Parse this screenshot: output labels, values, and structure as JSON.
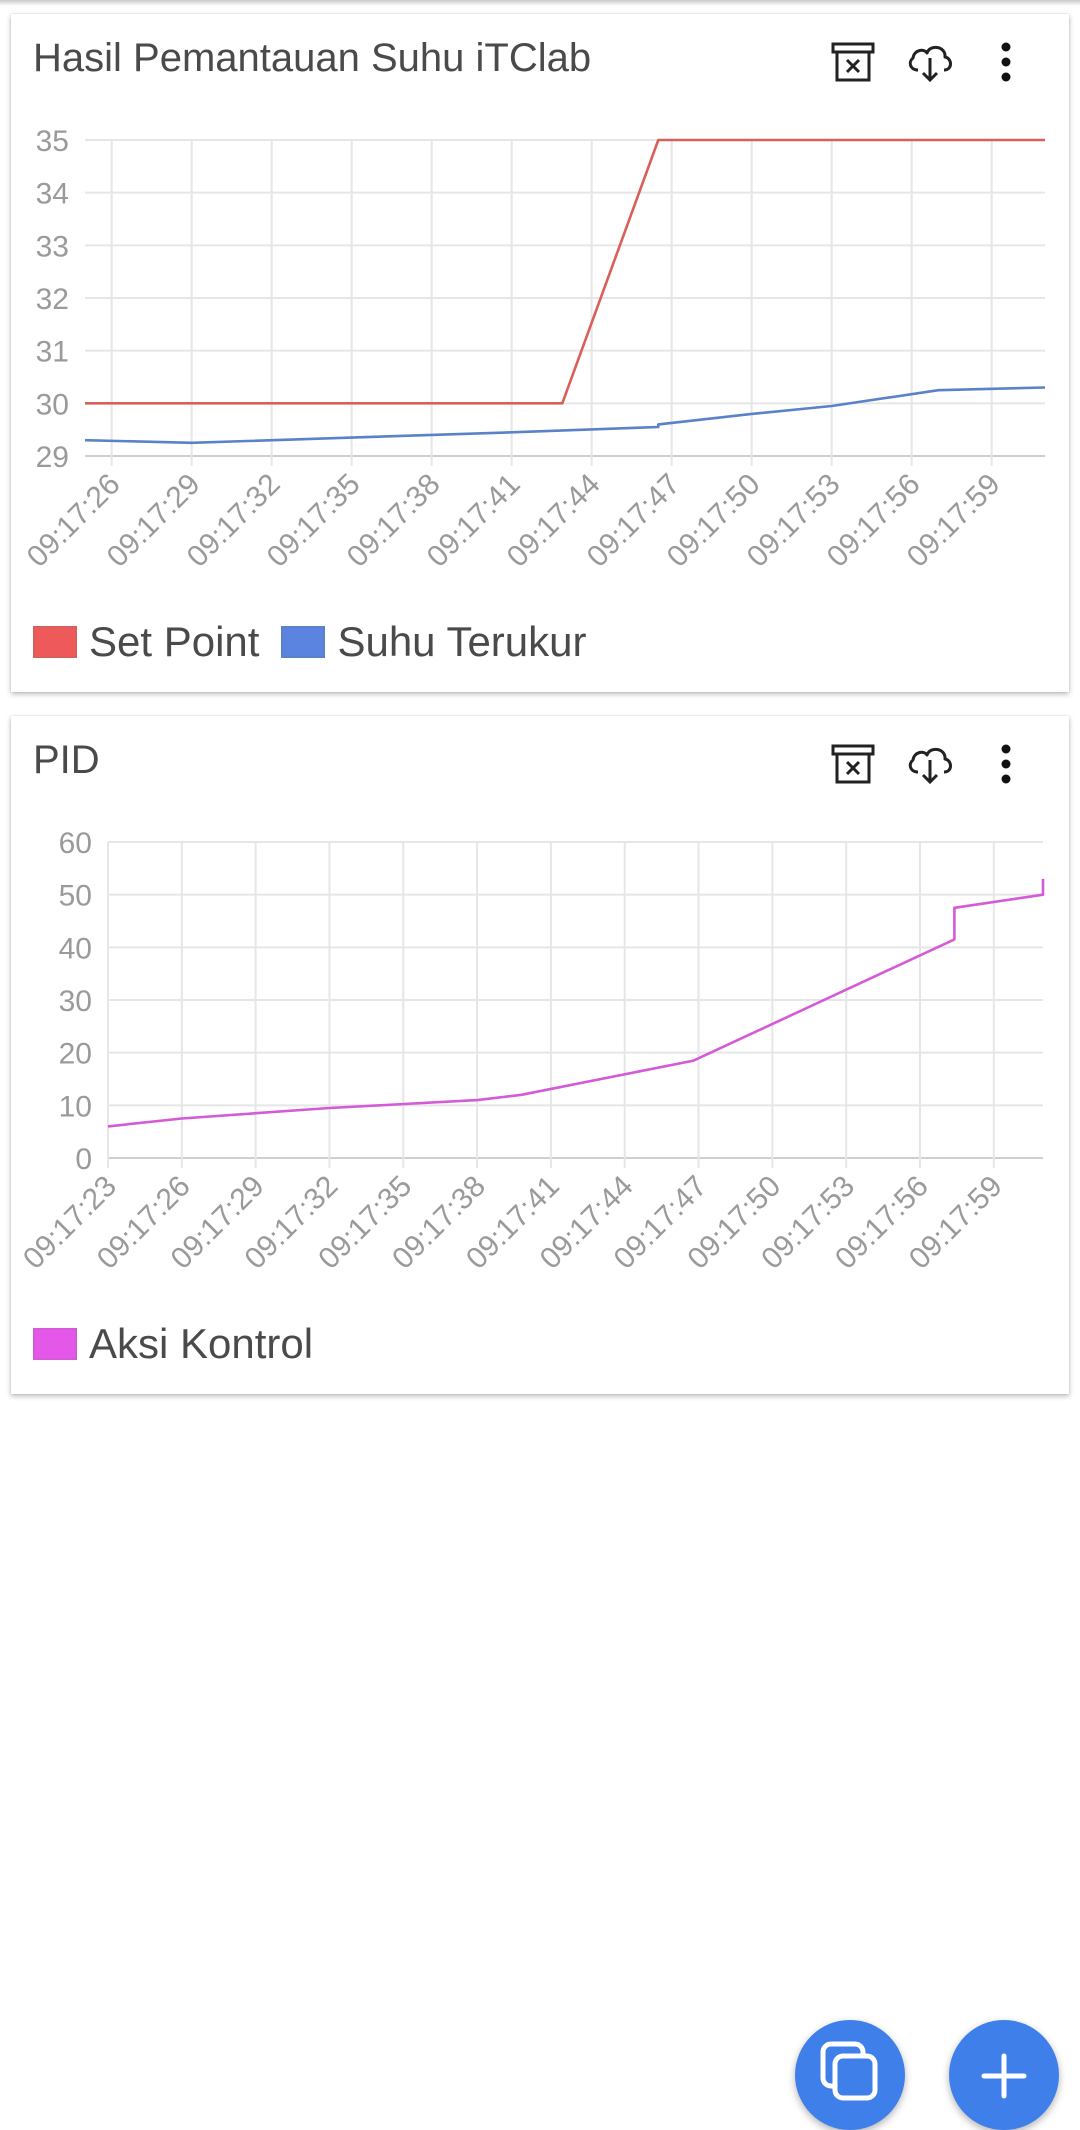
{
  "cards": [
    {
      "title": "Hasil Pemantauan Suhu iTClab",
      "actions": {
        "archive_icon": "archive-x-icon",
        "download_icon": "cloud-download-icon",
        "more_icon": "more-vertical-icon"
      }
    },
    {
      "title": "PID",
      "actions": {
        "archive_icon": "archive-x-icon",
        "download_icon": "cloud-download-icon",
        "more_icon": "more-vertical-icon"
      }
    }
  ],
  "fabs": {
    "copy_icon": "copy-icon",
    "add_icon": "plus-icon",
    "color": "#3f7fe9"
  },
  "chart_data": [
    {
      "type": "line",
      "title": "Hasil Pemantauan Suhu iTClab",
      "xlabel": "",
      "ylabel": "",
      "ylim": [
        29,
        35
      ],
      "yticks": [
        29,
        30,
        31,
        32,
        33,
        34,
        35
      ],
      "x_range": [
        "09:17:25",
        "09:18:01"
      ],
      "x_ticks": [
        "09:17:26",
        "09:17:29",
        "09:17:32",
        "09:17:35",
        "09:17:38",
        "09:17:41",
        "09:17:44",
        "09:17:47",
        "09:17:50",
        "09:17:53",
        "09:17:56",
        "09:17:59"
      ],
      "grid": true,
      "legend_position": "bottom-left",
      "series": [
        {
          "name": "Set Point",
          "color": "#d9605a",
          "legend_color": "#ee5a5a",
          "points": [
            [
              "09:17:25",
              30
            ],
            [
              "09:17:42.9",
              30
            ],
            [
              "09:17:46.5",
              35
            ],
            [
              "09:18:01",
              35
            ]
          ]
        },
        {
          "name": "Suhu Terukur",
          "color": "#5a82c8",
          "legend_color": "#5b84e0",
          "points": [
            [
              "09:17:25",
              29.3
            ],
            [
              "09:17:29",
              29.25
            ],
            [
              "09:17:35",
              29.35
            ],
            [
              "09:17:38",
              29.4
            ],
            [
              "09:17:41",
              29.45
            ],
            [
              "09:17:46.5",
              29.55
            ],
            [
              "09:17:46.5",
              29.6
            ],
            [
              "09:17:50",
              29.8
            ],
            [
              "09:17:53",
              29.95
            ],
            [
              "09:17:57",
              30.25
            ],
            [
              "09:18:01",
              30.3
            ]
          ]
        }
      ]
    },
    {
      "type": "line",
      "title": "PID",
      "xlabel": "",
      "ylabel": "",
      "ylim": [
        0,
        60
      ],
      "yticks": [
        0,
        10,
        20,
        30,
        40,
        50,
        60
      ],
      "x_range": [
        "09:17:23",
        "09:18:01"
      ],
      "x_ticks": [
        "09:17:23",
        "09:17:26",
        "09:17:29",
        "09:17:32",
        "09:17:35",
        "09:17:38",
        "09:17:41",
        "09:17:44",
        "09:17:47",
        "09:17:50",
        "09:17:53",
        "09:17:56",
        "09:17:59"
      ],
      "grid": true,
      "legend_position": "bottom-left",
      "series": [
        {
          "name": "Aksi Kontrol",
          "color": "#d45ad8",
          "legend_color": "#e557e8",
          "points": [
            [
              "09:17:23",
              6
            ],
            [
              "09:17:26",
              7.5
            ],
            [
              "09:17:32",
              9.5
            ],
            [
              "09:17:38",
              11
            ],
            [
              "09:17:39.8",
              12
            ],
            [
              "09:17:46.8",
              18.5
            ],
            [
              "09:17:57.4",
              41.5
            ],
            [
              "09:17:57.4",
              47.5
            ],
            [
              "09:18:01",
              50
            ],
            [
              "09:18:01",
              53
            ]
          ]
        }
      ]
    }
  ]
}
